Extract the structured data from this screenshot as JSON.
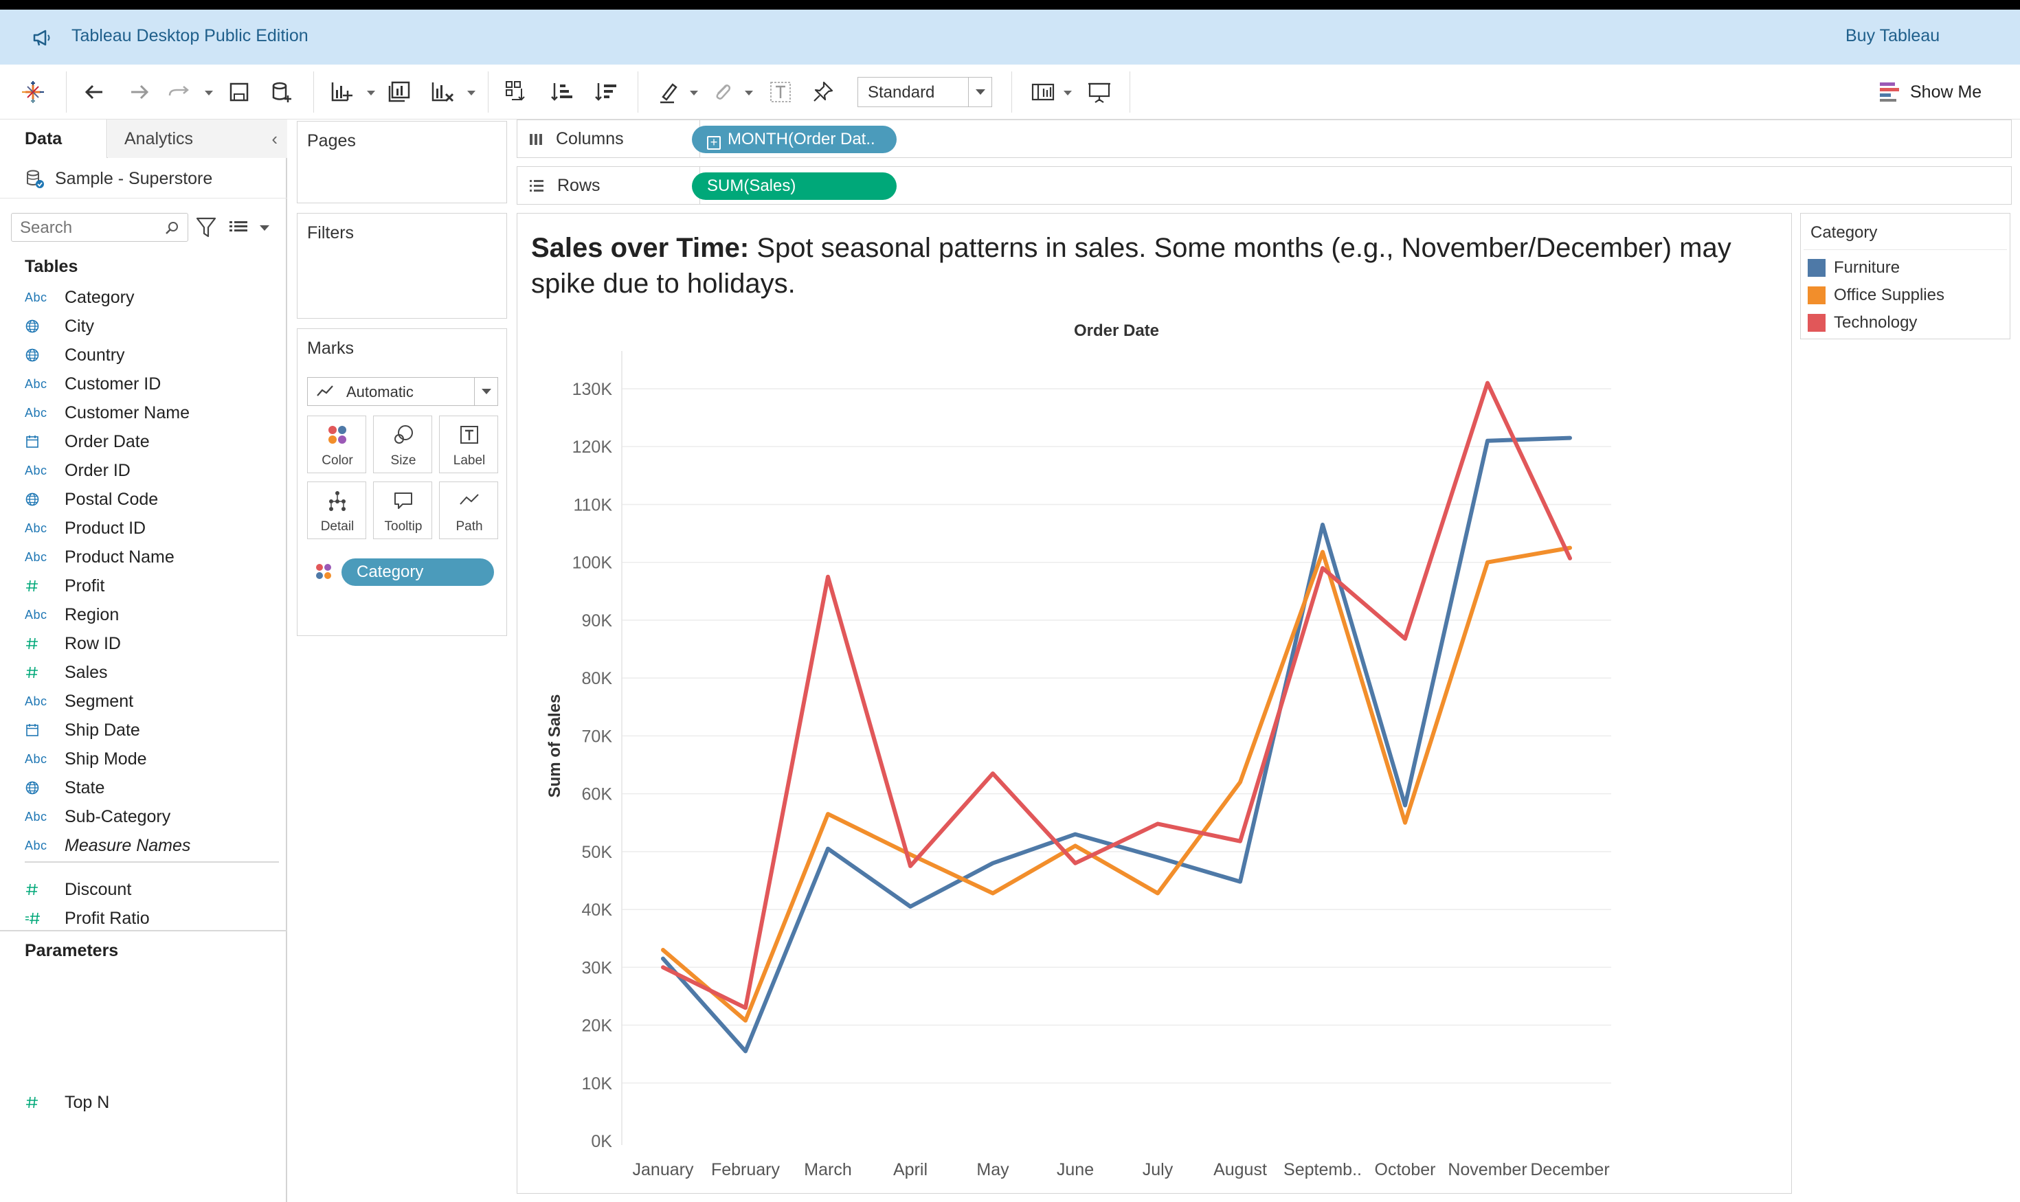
{
  "banner": {
    "title": "Tableau Desktop Public Edition",
    "buy_label": "Buy Tableau"
  },
  "toolbar": {
    "fit_select": "Standard",
    "show_me": "Show Me"
  },
  "left_panel": {
    "tabs": [
      "Data",
      "Analytics"
    ],
    "collapse_glyph": "‹",
    "datasource": "Sample - Superstore",
    "search_placeholder": "Search",
    "tables_heading": "Tables",
    "fields": [
      {
        "name": "Category",
        "type": "abc"
      },
      {
        "name": "City",
        "type": "geo"
      },
      {
        "name": "Country",
        "type": "geo"
      },
      {
        "name": "Customer ID",
        "type": "abc"
      },
      {
        "name": "Customer Name",
        "type": "abc"
      },
      {
        "name": "Order Date",
        "type": "date"
      },
      {
        "name": "Order ID",
        "type": "abc"
      },
      {
        "name": "Postal Code",
        "type": "geo"
      },
      {
        "name": "Product ID",
        "type": "abc"
      },
      {
        "name": "Product Name",
        "type": "abc"
      },
      {
        "name": "Profit",
        "type": "measure"
      },
      {
        "name": "Region",
        "type": "abc"
      },
      {
        "name": "Row ID",
        "type": "measure"
      },
      {
        "name": "Sales",
        "type": "measure"
      },
      {
        "name": "Segment",
        "type": "abc"
      },
      {
        "name": "Ship Date",
        "type": "date"
      },
      {
        "name": "Ship Mode",
        "type": "abc"
      },
      {
        "name": "State",
        "type": "geo"
      },
      {
        "name": "Sub-Category",
        "type": "abc"
      },
      {
        "name": "Measure Names",
        "type": "abc"
      }
    ],
    "measures": [
      {
        "name": "Discount",
        "type": "measure"
      },
      {
        "name": "Profit Ratio",
        "type": "calc"
      }
    ],
    "parameters_heading": "Parameters",
    "parameters": [
      {
        "name": "Top N",
        "type": "measure"
      }
    ]
  },
  "cards": {
    "pages": "Pages",
    "filters": "Filters",
    "marks": "Marks",
    "mark_type": "Automatic",
    "mark_buttons": [
      "Color",
      "Size",
      "Label",
      "Detail",
      "Tooltip",
      "Path"
    ],
    "color_pill": "Category"
  },
  "shelves": {
    "columns_label": "Columns",
    "columns_pill": "MONTH(Order Dat..",
    "rows_label": "Rows",
    "rows_pill": "SUM(Sales)"
  },
  "viz": {
    "title_bold": "Sales over Time:",
    "title_rest": " Spot seasonal patterns in sales. Some months (e.g., November/December) may spike due to holidays."
  },
  "legend": {
    "title": "Category",
    "items": [
      {
        "name": "Furniture",
        "color": "#4e79a7"
      },
      {
        "name": "Office Supplies",
        "color": "#f28e2b"
      },
      {
        "name": "Technology",
        "color": "#e15759"
      }
    ]
  },
  "chart_data": {
    "type": "line",
    "title": "",
    "xlabel": "Order Date",
    "ylabel": "Sum of Sales",
    "categories": [
      "January",
      "February",
      "March",
      "April",
      "May",
      "June",
      "July",
      "August",
      "Septemb..",
      "October",
      "November",
      "December"
    ],
    "ylim": [
      0,
      130000
    ],
    "yticks": [
      0,
      10000,
      20000,
      30000,
      40000,
      50000,
      60000,
      70000,
      80000,
      90000,
      100000,
      110000,
      120000,
      130000
    ],
    "ytick_labels": [
      "0K",
      "10K",
      "20K",
      "30K",
      "40K",
      "50K",
      "60K",
      "70K",
      "80K",
      "90K",
      "100K",
      "110K",
      "120K",
      "130K"
    ],
    "grid": true,
    "series": [
      {
        "name": "Furniture",
        "color": "#4e79a7",
        "values": [
          31500,
          15500,
          50500,
          40500,
          48000,
          53000,
          49000,
          44800,
          106500,
          58000,
          121000,
          121500
        ]
      },
      {
        "name": "Office Supplies",
        "color": "#f28e2b",
        "values": [
          33000,
          20800,
          56500,
          49500,
          42800,
          51000,
          42800,
          62000,
          101800,
          55000,
          100000,
          102500
        ]
      },
      {
        "name": "Technology",
        "color": "#e15759",
        "values": [
          30000,
          23000,
          97500,
          47500,
          63500,
          48000,
          54800,
          51800,
          99000,
          86800,
          131000,
          100700
        ]
      }
    ]
  }
}
